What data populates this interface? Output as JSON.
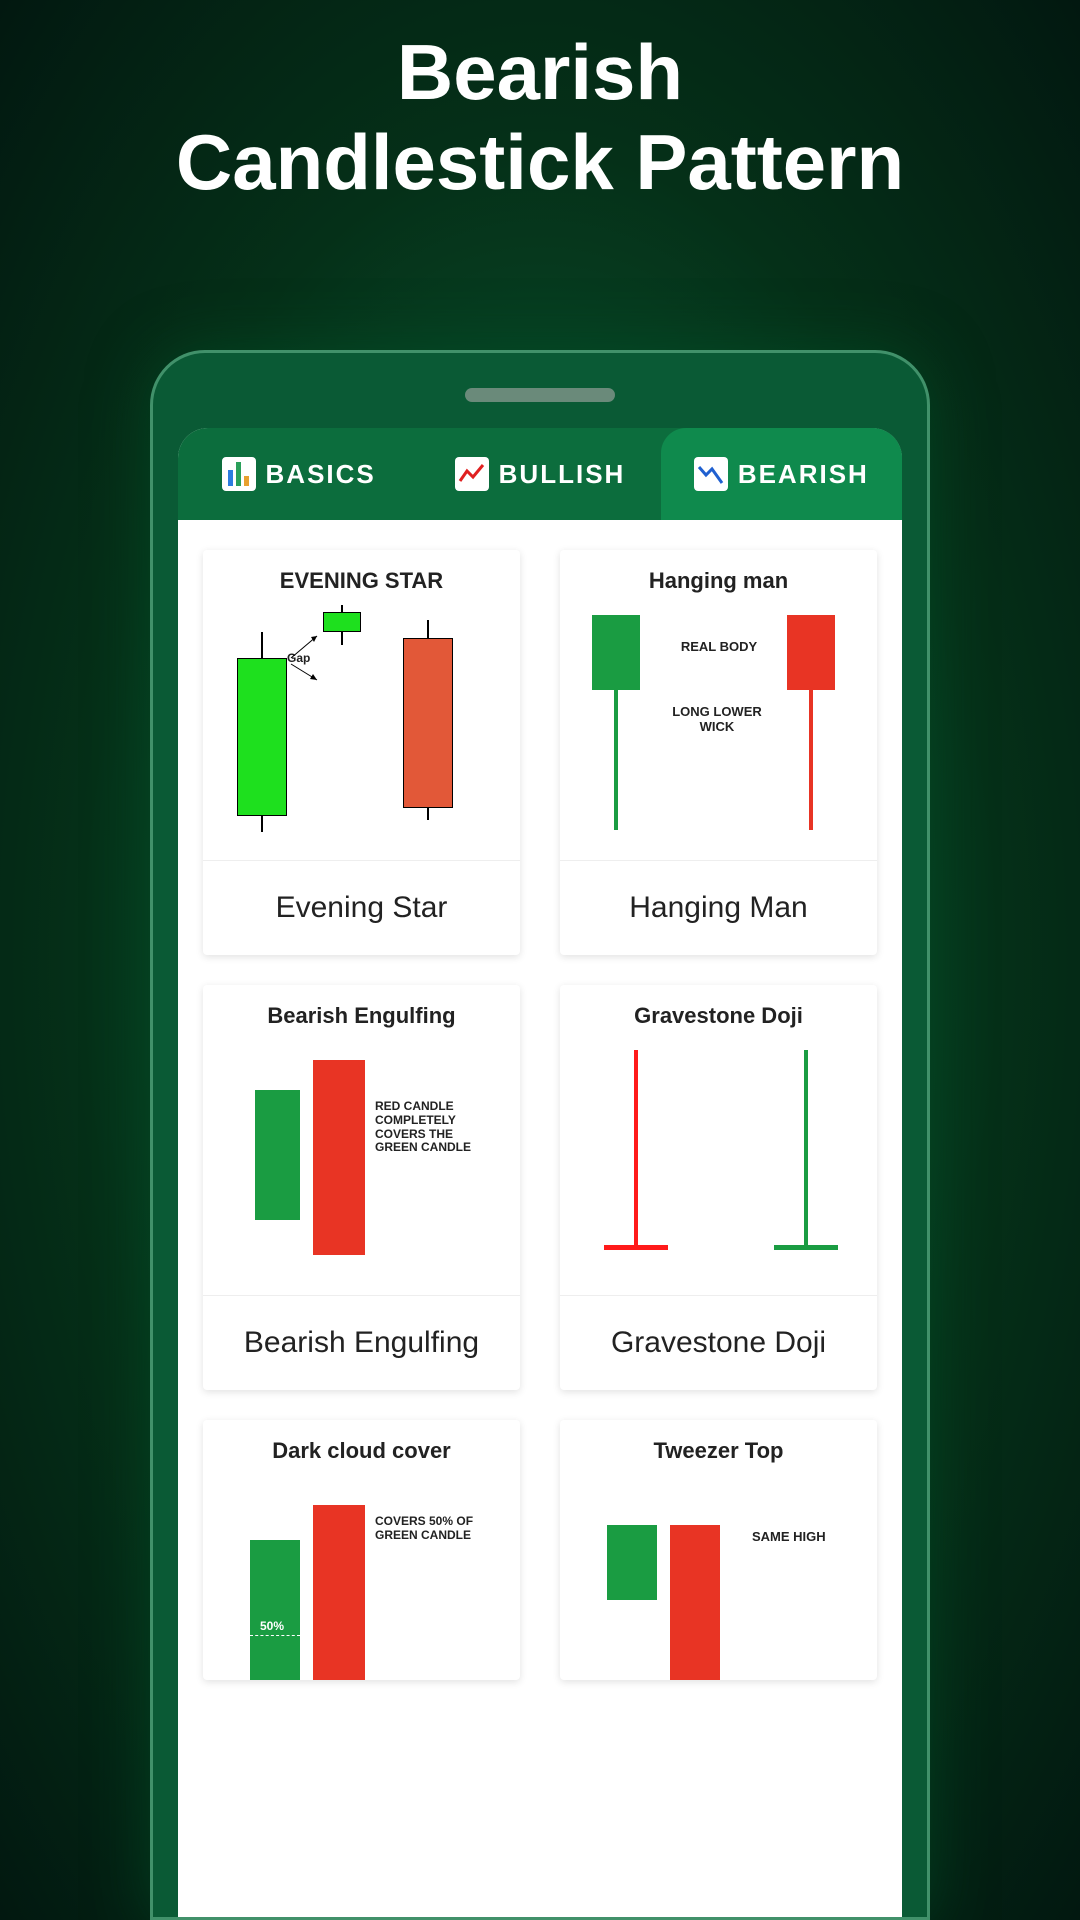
{
  "page_title_line1": "Bearish",
  "page_title_line2": "Candlestick Pattern",
  "tabs": [
    {
      "label": "BASICS",
      "active": false
    },
    {
      "label": "BULLISH",
      "active": false
    },
    {
      "label": "BEARISH",
      "active": true
    }
  ],
  "cards": [
    {
      "img_title": "EVENING STAR",
      "label": "Evening Star",
      "annotations": {
        "gap": "Gap"
      }
    },
    {
      "img_title": "Hanging man",
      "label": "Hanging Man",
      "annotations": {
        "body": "REAL BODY",
        "wick": "LONG LOWER WICK"
      }
    },
    {
      "img_title": "Bearish Engulfing",
      "label": "Bearish Engulfing",
      "annotations": {
        "note": "RED CANDLE COMPLETELY COVERS THE GREEN CANDLE"
      }
    },
    {
      "img_title": "Gravestone Doji",
      "label": "Gravestone Doji",
      "annotations": {}
    },
    {
      "img_title": "Dark cloud cover",
      "label": "",
      "annotations": {
        "note": "COVERS 50% OF GREEN CANDLE",
        "pct": "50%"
      }
    },
    {
      "img_title": "Tweezer Top",
      "label": "",
      "annotations": {
        "note": "SAME HIGH"
      }
    }
  ],
  "colors": {
    "green_bright": "#1ee01e",
    "green_dark": "#1a9c42",
    "red": "#e83424",
    "red_bright": "#ff1a1a",
    "orange_red": "#e25838"
  }
}
